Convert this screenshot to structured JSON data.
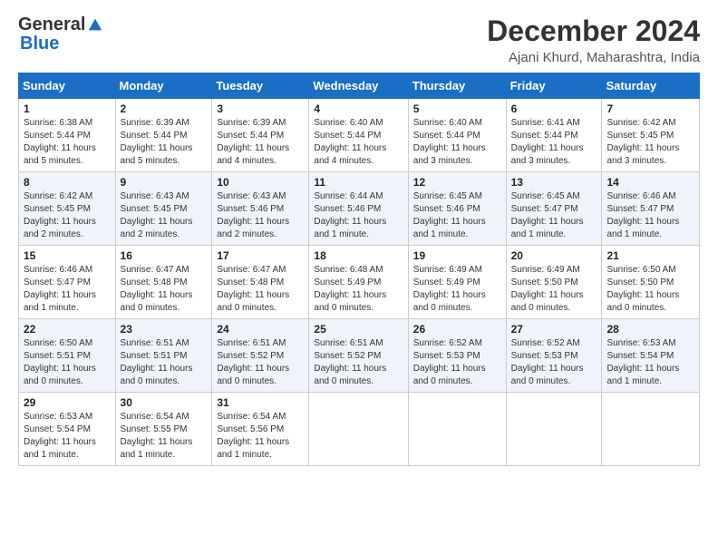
{
  "logo": {
    "general": "General",
    "blue": "Blue"
  },
  "title": "December 2024",
  "location": "Ajani Khurd, Maharashtra, India",
  "days_of_week": [
    "Sunday",
    "Monday",
    "Tuesday",
    "Wednesday",
    "Thursday",
    "Friday",
    "Saturday"
  ],
  "weeks": [
    [
      {
        "day": "1",
        "sunrise": "6:38 AM",
        "sunset": "5:44 PM",
        "daylight": "11 hours and 5 minutes."
      },
      {
        "day": "2",
        "sunrise": "6:39 AM",
        "sunset": "5:44 PM",
        "daylight": "11 hours and 5 minutes."
      },
      {
        "day": "3",
        "sunrise": "6:39 AM",
        "sunset": "5:44 PM",
        "daylight": "11 hours and 4 minutes."
      },
      {
        "day": "4",
        "sunrise": "6:40 AM",
        "sunset": "5:44 PM",
        "daylight": "11 hours and 4 minutes."
      },
      {
        "day": "5",
        "sunrise": "6:40 AM",
        "sunset": "5:44 PM",
        "daylight": "11 hours and 3 minutes."
      },
      {
        "day": "6",
        "sunrise": "6:41 AM",
        "sunset": "5:44 PM",
        "daylight": "11 hours and 3 minutes."
      },
      {
        "day": "7",
        "sunrise": "6:42 AM",
        "sunset": "5:45 PM",
        "daylight": "11 hours and 3 minutes."
      }
    ],
    [
      {
        "day": "8",
        "sunrise": "6:42 AM",
        "sunset": "5:45 PM",
        "daylight": "11 hours and 2 minutes."
      },
      {
        "day": "9",
        "sunrise": "6:43 AM",
        "sunset": "5:45 PM",
        "daylight": "11 hours and 2 minutes."
      },
      {
        "day": "10",
        "sunrise": "6:43 AM",
        "sunset": "5:46 PM",
        "daylight": "11 hours and 2 minutes."
      },
      {
        "day": "11",
        "sunrise": "6:44 AM",
        "sunset": "5:46 PM",
        "daylight": "11 hours and 1 minute."
      },
      {
        "day": "12",
        "sunrise": "6:45 AM",
        "sunset": "5:46 PM",
        "daylight": "11 hours and 1 minute."
      },
      {
        "day": "13",
        "sunrise": "6:45 AM",
        "sunset": "5:47 PM",
        "daylight": "11 hours and 1 minute."
      },
      {
        "day": "14",
        "sunrise": "6:46 AM",
        "sunset": "5:47 PM",
        "daylight": "11 hours and 1 minute."
      }
    ],
    [
      {
        "day": "15",
        "sunrise": "6:46 AM",
        "sunset": "5:47 PM",
        "daylight": "11 hours and 1 minute."
      },
      {
        "day": "16",
        "sunrise": "6:47 AM",
        "sunset": "5:48 PM",
        "daylight": "11 hours and 0 minutes."
      },
      {
        "day": "17",
        "sunrise": "6:47 AM",
        "sunset": "5:48 PM",
        "daylight": "11 hours and 0 minutes."
      },
      {
        "day": "18",
        "sunrise": "6:48 AM",
        "sunset": "5:49 PM",
        "daylight": "11 hours and 0 minutes."
      },
      {
        "day": "19",
        "sunrise": "6:49 AM",
        "sunset": "5:49 PM",
        "daylight": "11 hours and 0 minutes."
      },
      {
        "day": "20",
        "sunrise": "6:49 AM",
        "sunset": "5:50 PM",
        "daylight": "11 hours and 0 minutes."
      },
      {
        "day": "21",
        "sunrise": "6:50 AM",
        "sunset": "5:50 PM",
        "daylight": "11 hours and 0 minutes."
      }
    ],
    [
      {
        "day": "22",
        "sunrise": "6:50 AM",
        "sunset": "5:51 PM",
        "daylight": "11 hours and 0 minutes."
      },
      {
        "day": "23",
        "sunrise": "6:51 AM",
        "sunset": "5:51 PM",
        "daylight": "11 hours and 0 minutes."
      },
      {
        "day": "24",
        "sunrise": "6:51 AM",
        "sunset": "5:52 PM",
        "daylight": "11 hours and 0 minutes."
      },
      {
        "day": "25",
        "sunrise": "6:51 AM",
        "sunset": "5:52 PM",
        "daylight": "11 hours and 0 minutes."
      },
      {
        "day": "26",
        "sunrise": "6:52 AM",
        "sunset": "5:53 PM",
        "daylight": "11 hours and 0 minutes."
      },
      {
        "day": "27",
        "sunrise": "6:52 AM",
        "sunset": "5:53 PM",
        "daylight": "11 hours and 0 minutes."
      },
      {
        "day": "28",
        "sunrise": "6:53 AM",
        "sunset": "5:54 PM",
        "daylight": "11 hours and 1 minute."
      }
    ],
    [
      {
        "day": "29",
        "sunrise": "6:53 AM",
        "sunset": "5:54 PM",
        "daylight": "11 hours and 1 minute."
      },
      {
        "day": "30",
        "sunrise": "6:54 AM",
        "sunset": "5:55 PM",
        "daylight": "11 hours and 1 minute."
      },
      {
        "day": "31",
        "sunrise": "6:54 AM",
        "sunset": "5:56 PM",
        "daylight": "11 hours and 1 minute."
      },
      null,
      null,
      null,
      null
    ]
  ]
}
